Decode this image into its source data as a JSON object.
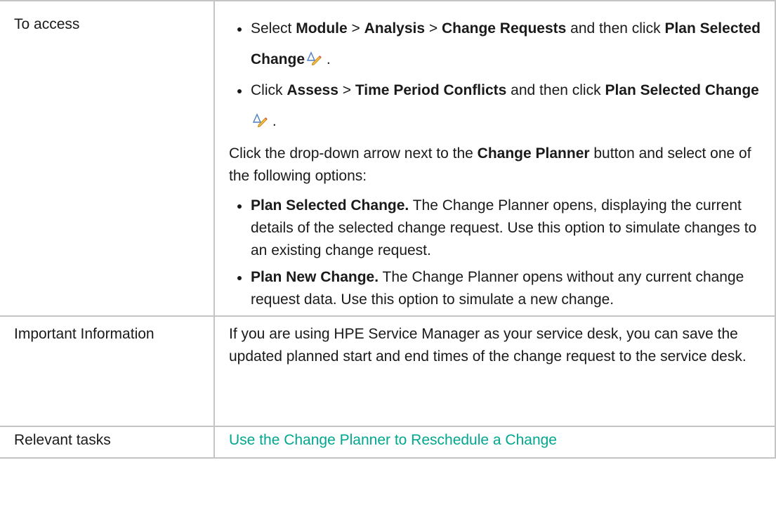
{
  "rows": {
    "access": {
      "label": "To access",
      "bullet1": {
        "t1": "Select ",
        "b1": "Module",
        "t2": " > ",
        "b2": "Analysis",
        "t3": " > ",
        "b3": "Change Requests",
        "t4": " and then click ",
        "b4": "Plan Selected Change",
        "t5": " ."
      },
      "bullet2": {
        "t1": "Click ",
        "b1": "Assess",
        "t2": " > ",
        "b2": "Time Period Conflicts",
        "t3": " and then click ",
        "b3": "Plan Selected Change",
        "t4": " ."
      },
      "intro": {
        "t1": "Click the drop-down arrow next to the ",
        "b1": "Change Planner",
        "t2": " button and select one of the following options:"
      },
      "options": [
        {
          "title": "Plan Selected Change.",
          "text": " The Change Planner opens, displaying the current details of the selected change request. Use this option to simulate changes to an existing change request."
        },
        {
          "title": "Plan New Change.",
          "text": " The Change Planner opens without any current change request data. Use this option to simulate a new change."
        }
      ]
    },
    "important": {
      "label": "Important Information",
      "text": "If you are using HPE Service Manager as your service desk, you can save the updated planned start and end times of the change request to the service desk."
    },
    "tasks": {
      "label": "Relevant tasks",
      "link": "Use the Change Planner to Reschedule a Change"
    }
  },
  "colors": {
    "border": "#c4c4c4",
    "link": "#00a78e",
    "text": "#1a1a1a"
  },
  "icons": [
    "plan-change-pencil-icon"
  ]
}
